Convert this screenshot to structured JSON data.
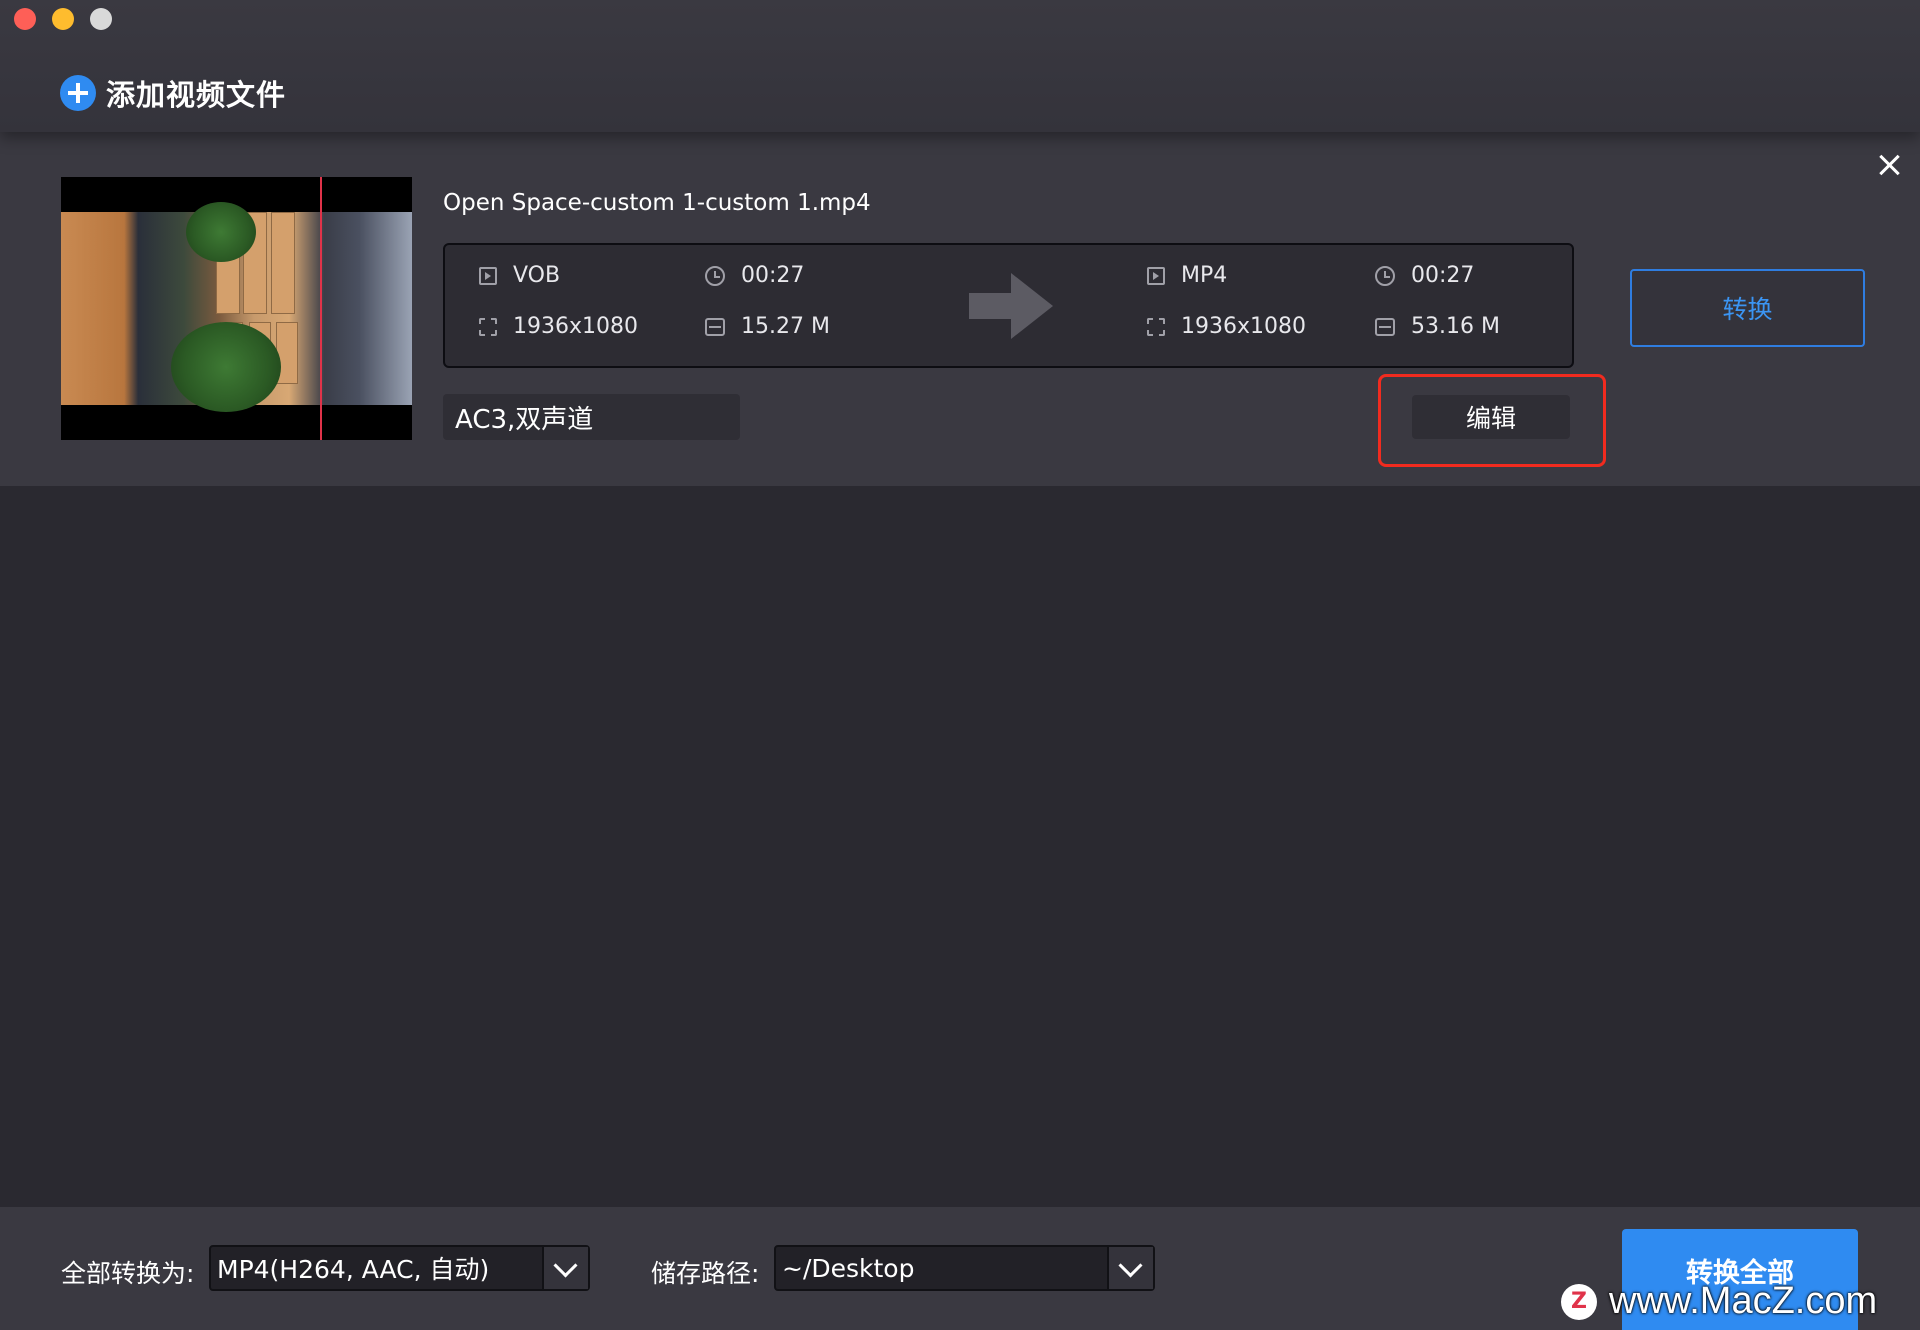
{
  "toolbar": {
    "add_label": "添加视频文件"
  },
  "file": {
    "name": "Open Space-custom 1-custom 1.mp4",
    "source": {
      "format": "VOB",
      "duration": "00:27",
      "resolution": "1936x1080",
      "size": "15.27 M"
    },
    "target": {
      "format": "MP4",
      "duration": "00:27",
      "resolution": "1936x1080",
      "size": "53.16 M"
    },
    "audio": "AC3,双声道",
    "convert_label": "转换",
    "edit_label": "编辑"
  },
  "bottom": {
    "convert_all_to_label": "全部转换为:",
    "convert_all_to_value": "MP4(H264, AAC, 自动)",
    "save_path_label": "储存路径:",
    "save_path_value": "~/Desktop",
    "convert_all_label": "转换全部"
  },
  "watermark": {
    "logo": "Z",
    "text": "www.MacZ.com"
  },
  "colors": {
    "accent": "#2f8bf1",
    "highlight": "#f12b1f",
    "background": "#2a2930",
    "panel": "#3a3941"
  }
}
